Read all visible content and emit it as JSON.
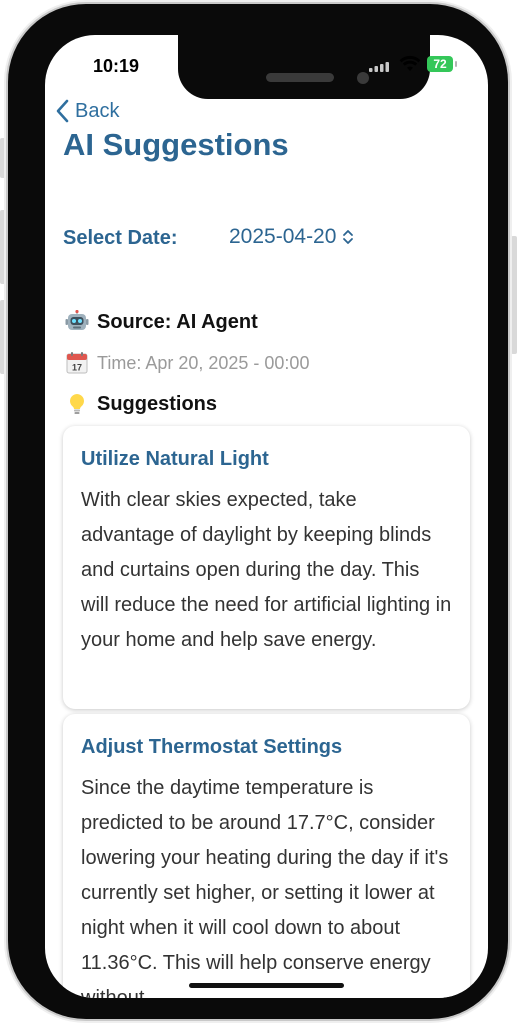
{
  "status_bar": {
    "time": "10:19",
    "battery": "72"
  },
  "nav": {
    "back_label": "Back"
  },
  "page": {
    "title": "AI Suggestions"
  },
  "date_select": {
    "label": "Select Date:",
    "value": "2025-04-20"
  },
  "info": {
    "source_icon": "robot-emoji-icon",
    "source": "Source: AI Agent",
    "time_icon": "calendar-emoji-icon",
    "time": "Time: Apr 20, 2025 - 00:00",
    "suggestions_icon": "lightbulb-emoji-icon",
    "suggestions_heading": "Suggestions"
  },
  "suggestions": [
    {
      "title": "Utilize Natural Light",
      "body": "With clear skies expected, take advantage of daylight by keeping blinds and curtains open during the day. This will reduce the need for artificial lighting in your home and help save energy."
    },
    {
      "title": "Adjust Thermostat Settings",
      "body": "Since the daytime temperature is predicted to be around 17.7°C, consider lowering your heating during the day if it's currently set higher, or setting it lower at night when it will cool down to about 11.36°C. This will help conserve energy without"
    }
  ],
  "colors": {
    "accent": "#2c6591",
    "link": "#2f6f9f",
    "battery": "#34c759"
  }
}
